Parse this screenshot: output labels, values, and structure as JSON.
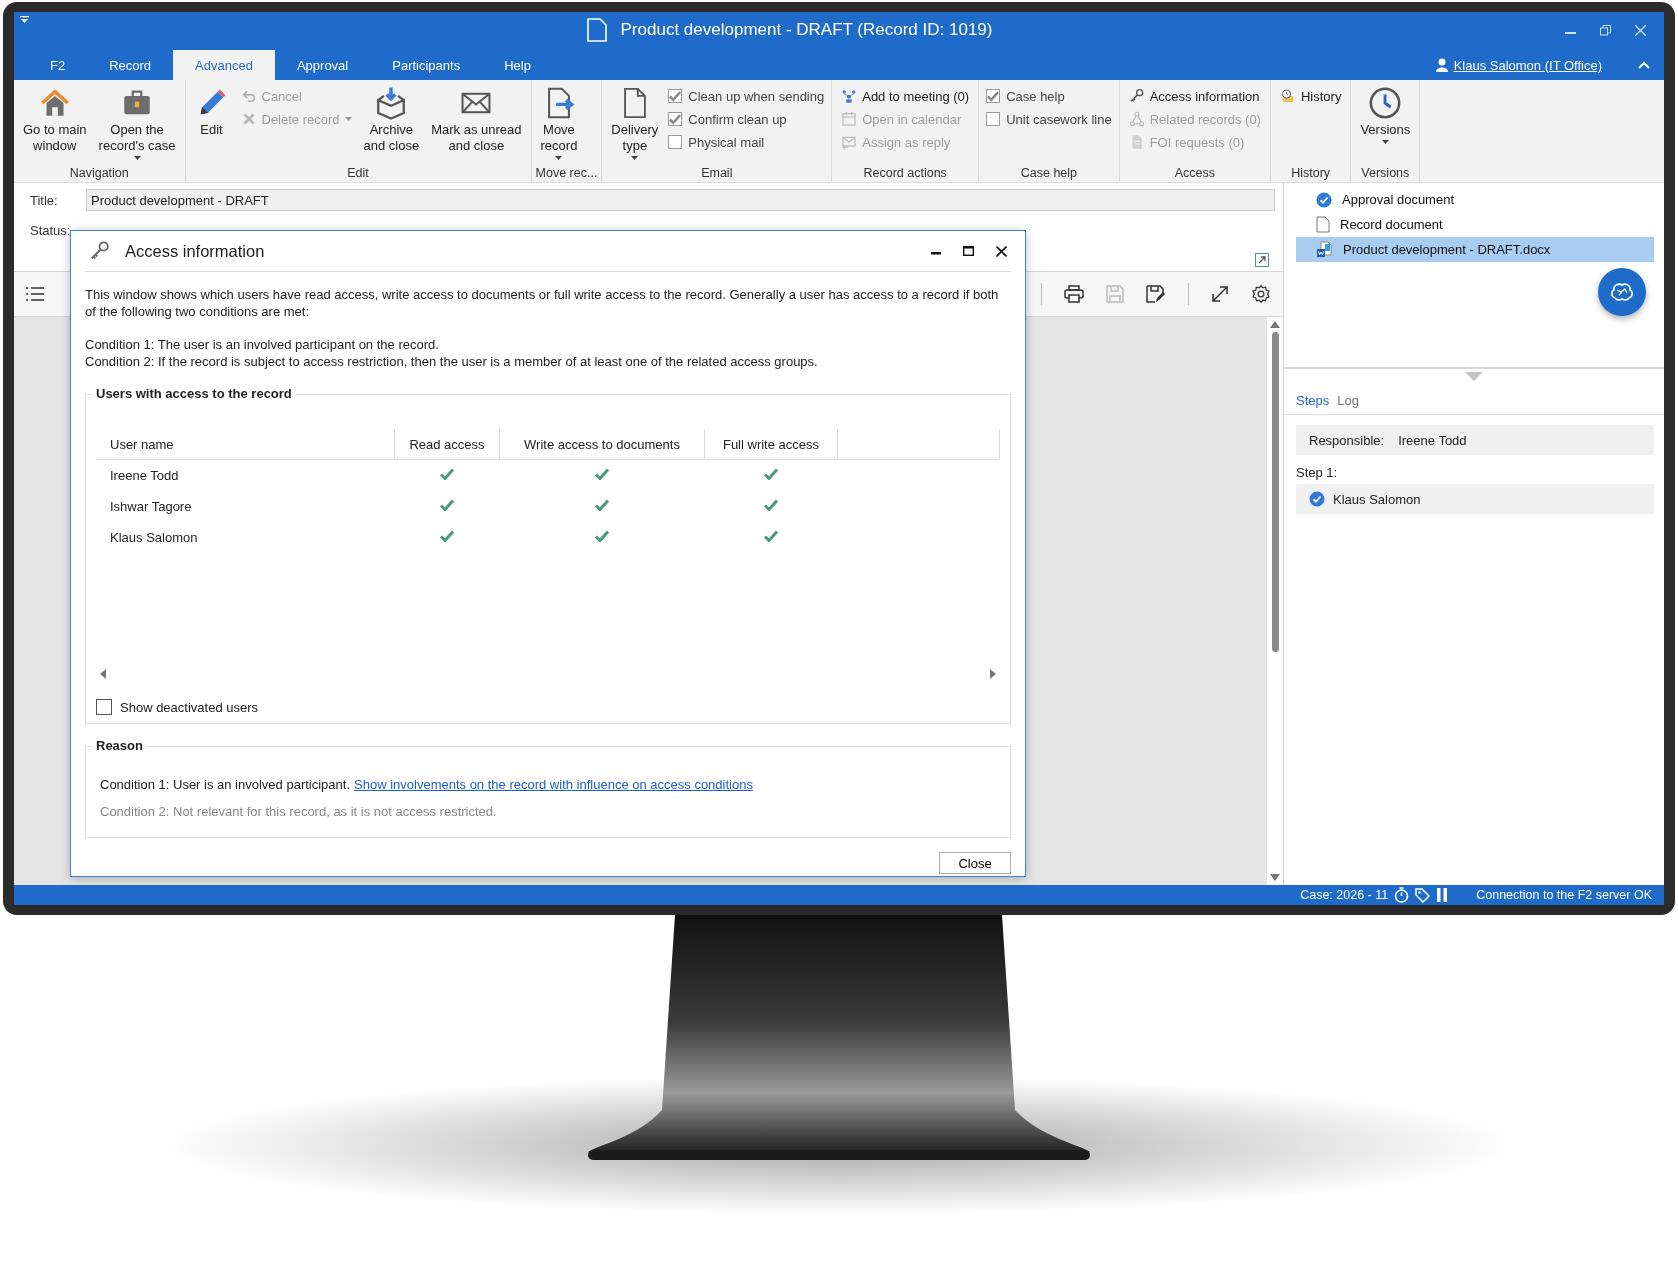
{
  "window": {
    "title": "Product development - DRAFT (Record ID: 1019)",
    "user": "Klaus Salomon (IT Office)"
  },
  "tabs": [
    {
      "label": "F2",
      "selected": false
    },
    {
      "label": "Record",
      "selected": false
    },
    {
      "label": "Advanced",
      "selected": true
    },
    {
      "label": "Approval",
      "selected": false
    },
    {
      "label": "Participants",
      "selected": false
    },
    {
      "label": "Help",
      "selected": false
    }
  ],
  "ribbon_groups": [
    {
      "label": "Navigation",
      "items": [
        {
          "kind": "large",
          "label": "Go to main\nwindow",
          "dropdown": false,
          "disabled": false
        },
        {
          "kind": "large",
          "label": "Open the\nrecord's case",
          "dropdown": true,
          "disabled": false
        }
      ]
    },
    {
      "label": "Edit",
      "items": [
        {
          "kind": "large",
          "label": "Edit",
          "dropdown": false,
          "disabled": false
        },
        {
          "kind": "small",
          "label": "Cancel",
          "dropdown": false,
          "disabled": true
        },
        {
          "kind": "small",
          "label": "Delete record",
          "dropdown": true,
          "disabled": true
        },
        {
          "kind": "large",
          "label": "Archive\nand close",
          "dropdown": false,
          "disabled": false
        },
        {
          "kind": "large",
          "label": "Mark as unread\nand close",
          "dropdown": false,
          "disabled": false
        }
      ]
    },
    {
      "label": "Move rec...",
      "items": [
        {
          "kind": "large",
          "label": "Move\nrecord",
          "dropdown": true,
          "disabled": false
        }
      ]
    },
    {
      "label": "Email",
      "items": [
        {
          "kind": "large",
          "label": "Delivery\ntype",
          "dropdown": true,
          "disabled": false
        },
        {
          "kind": "check",
          "label": "Clean up when sending",
          "checked": true
        },
        {
          "kind": "check",
          "label": "Confirm clean up",
          "checked": true
        },
        {
          "kind": "check",
          "label": "Physical mail",
          "checked": false
        }
      ]
    },
    {
      "label": "Record actions",
      "items": [
        {
          "kind": "small",
          "label": "Add to meeting (0)",
          "dropdown": false,
          "disabled": false
        },
        {
          "kind": "small",
          "label": "Open in calendar",
          "dropdown": false,
          "disabled": true
        },
        {
          "kind": "small",
          "label": "Assign as reply",
          "dropdown": false,
          "disabled": true
        }
      ]
    },
    {
      "label": "Case help",
      "items": [
        {
          "kind": "check",
          "label": "Case help",
          "checked": true
        },
        {
          "kind": "check",
          "label": "Unit casework line",
          "checked": false
        }
      ]
    },
    {
      "label": "Access",
      "items": [
        {
          "kind": "small",
          "label": "Access information",
          "dropdown": false,
          "disabled": false
        },
        {
          "kind": "small",
          "label": "Related records (0)",
          "dropdown": false,
          "disabled": true
        },
        {
          "kind": "small",
          "label": "FOI requests (0)",
          "dropdown": false,
          "disabled": true
        }
      ]
    },
    {
      "label": "History",
      "items": [
        {
          "kind": "small",
          "label": "History",
          "dropdown": false,
          "disabled": false
        }
      ]
    },
    {
      "label": "Versions",
      "items": [
        {
          "kind": "large",
          "label": "Versions",
          "dropdown": true,
          "disabled": false
        }
      ]
    }
  ],
  "record": {
    "title_label": "Title:",
    "title_value": "Product development - DRAFT",
    "status_label": "Status:"
  },
  "dialog": {
    "title": "Access information",
    "intro": "This window shows which users have read access, write access to documents or full write access to the record. Generally a user has access to a record if both of the following two conditions are met:",
    "conditions": [
      "Condition 1: The user is an involved participant on the record.",
      "Condition 2: If the record is subject to access restriction, then the user is a member of at least one of the related access groups."
    ],
    "users_group": "Users with access to the record",
    "columns": [
      "User name",
      "Read access",
      "Write access to documents",
      "Full write access"
    ],
    "rows": [
      {
        "name": "Ireene Todd",
        "read": true,
        "write_documents": true,
        "full_write": true
      },
      {
        "name": "Ishwar Tagore",
        "read": true,
        "write_documents": true,
        "full_write": true
      },
      {
        "name": "Klaus Salomon",
        "read": true,
        "write_documents": true,
        "full_write": true
      }
    ],
    "show_deactivated": {
      "label": "Show deactivated users",
      "checked": false
    },
    "reason_group": "Reason",
    "reason_1": "Condition 1: User is an involved participant.",
    "reason_link": "Show involvements on the record with influence on access conditions",
    "reason_2": "Condition 2: Not relevant for this record, as it is not access restricted.",
    "close": "Close"
  },
  "documents": [
    {
      "kind": "approval",
      "name": "Approval document",
      "selected": false
    },
    {
      "kind": "document",
      "name": "Record document",
      "selected": false
    },
    {
      "kind": "word",
      "name": "Product development - DRAFT.docx",
      "selected": true
    }
  ],
  "flow_tabs": [
    {
      "label": "Steps",
      "selected": true
    },
    {
      "label": "Log",
      "selected": false
    }
  ],
  "responsible": {
    "label": "Responsible:",
    "value": "Ireene Todd"
  },
  "step": {
    "label": "Step 1:",
    "person": "Klaus Salomon"
  },
  "status_bar": {
    "case": "Case: 2026 - 11",
    "connection": "Connection to the F2 server OK"
  }
}
